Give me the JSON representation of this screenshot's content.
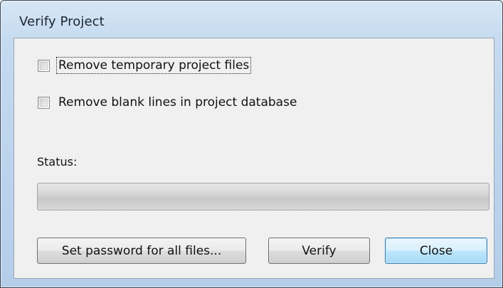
{
  "window": {
    "title": "Verify Project"
  },
  "options": [
    {
      "label": "Remove temporary project files",
      "checked": false,
      "focused": true
    },
    {
      "label": "Remove blank lines in project database",
      "checked": false,
      "focused": false
    }
  ],
  "status": {
    "label": "Status:",
    "progress": 0
  },
  "buttons": {
    "set_password": "Set password for all files...",
    "verify": "Verify",
    "close": "Close",
    "default_button": "close"
  },
  "colors": {
    "title_bar": "#c5daf0",
    "client_bg": "#f0f0f0",
    "default_button_border": "#3c7fb1"
  }
}
